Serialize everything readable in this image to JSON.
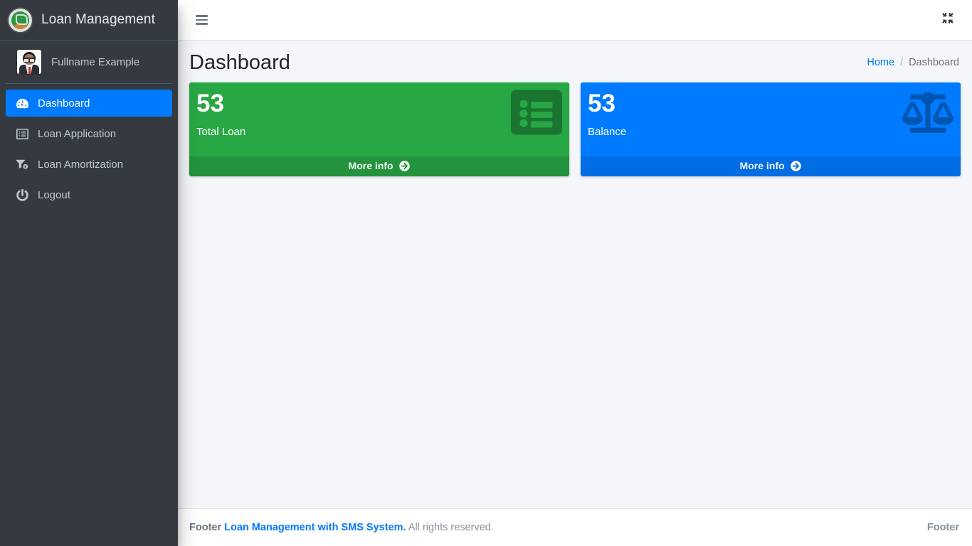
{
  "brand": {
    "title": "Loan Management",
    "logo_icon": "globe-logo-icon"
  },
  "user_panel": {
    "name": "Fullname Example",
    "avatar_icon": "user-avatar"
  },
  "sidebar": {
    "items": [
      {
        "label": "Dashboard",
        "icon": "tachometer-icon",
        "active": true
      },
      {
        "label": "Loan Application",
        "icon": "list-alt-icon",
        "active": false
      },
      {
        "label": "Loan Amortization",
        "icon": "filter-dollar-icon",
        "active": false
      },
      {
        "label": "Logout",
        "icon": "power-off-icon",
        "active": false
      }
    ]
  },
  "navbar": {
    "menu_toggle_icon": "hamburger-icon",
    "fullscreen_icon": "compress-icon"
  },
  "header": {
    "title": "Dashboard",
    "breadcrumb": {
      "home": "Home",
      "separator": "/",
      "current": "Dashboard"
    }
  },
  "cards": [
    {
      "value": "53",
      "label": "Total Loan",
      "more_info": "More info",
      "color": "#28a745",
      "icon": "list-alt-icon",
      "variant": "green"
    },
    {
      "value": "53",
      "label": "Balance",
      "more_info": "More info",
      "color": "#007bff",
      "icon": "balance-scale-icon",
      "variant": "blue"
    }
  ],
  "footer": {
    "prefix": "Footer",
    "link": "Loan Management with SMS System.",
    "suffix": "All rights reserved.",
    "right": "Footer"
  },
  "colors": {
    "sidebar_bg": "#343a40",
    "content_bg": "#f4f6f9",
    "accent": "#007bff",
    "success": "#28a745",
    "muted_text": "#c2c7d0"
  }
}
